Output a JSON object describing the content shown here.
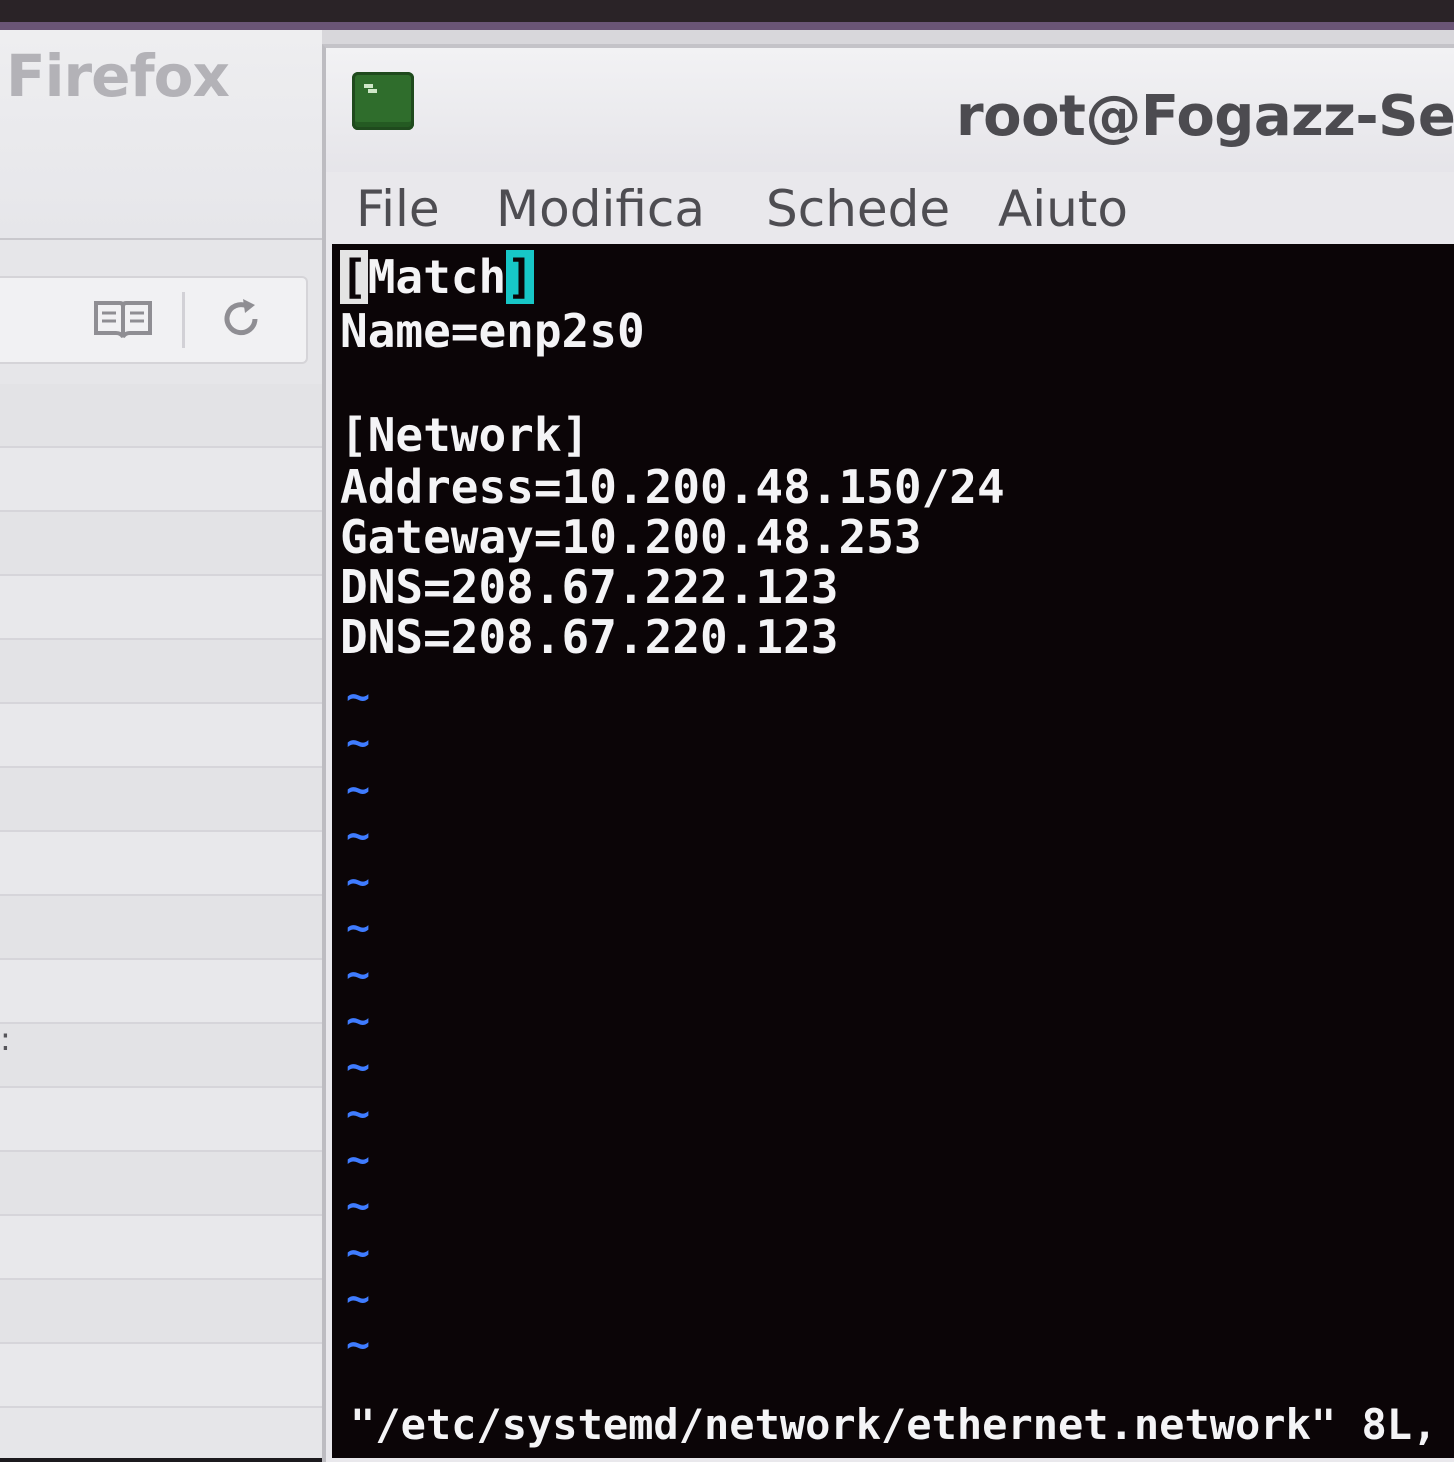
{
  "firefox": {
    "title": "Firefox",
    "sidebar_marker": ":"
  },
  "terminal": {
    "title": "root@Fogazz-Se",
    "menu": [
      "File",
      "Modifica",
      "Schede",
      "Aiuto"
    ],
    "vim": {
      "lines": [
        "[Match]",
        "Name=enp2s0",
        "",
        "[Network]",
        "Address=10.200.48.150/24",
        "Gateway=10.200.48.253",
        "DNS=208.67.222.123",
        "DNS=208.67.220.123"
      ],
      "cursor_line_parts": {
        "open_bracket": "[",
        "word": "Match",
        "close_bracket": "]"
      },
      "empty_line_marker": "~",
      "status": "\"/etc/systemd/network/ethernet.network\" 8L,"
    }
  }
}
